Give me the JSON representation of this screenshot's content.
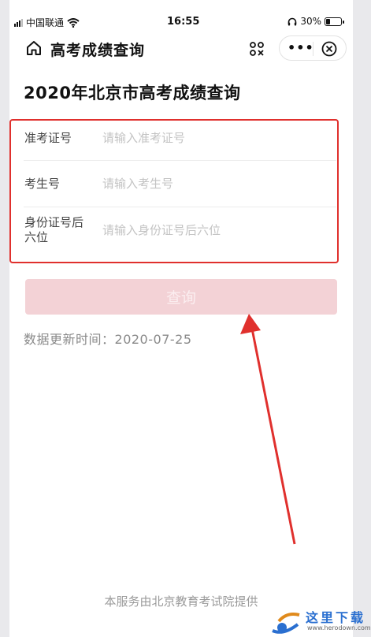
{
  "status_bar": {
    "carrier": "中国联通",
    "time": "16:55",
    "battery": "30%",
    "battery_level": 0.3
  },
  "nav": {
    "title": "高考成绩查询",
    "more_label": "•••"
  },
  "page": {
    "title": "2020年北京市高考成绩查询"
  },
  "form": {
    "fields": [
      {
        "label": "准考证号",
        "placeholder": "请输入准考证号",
        "value": ""
      },
      {
        "label": "考生号",
        "placeholder": "请输入考生号",
        "value": ""
      },
      {
        "label": "身份证号后六位",
        "placeholder": "请输入身份证号后六位",
        "value": ""
      }
    ],
    "submit_label": "查询"
  },
  "update": {
    "label": "数据更新时间：",
    "date": "2020-07-25"
  },
  "footer": {
    "text": "本服务由北京教育考试院提供"
  },
  "watermark": {
    "text": "这里下载",
    "sub": "www.herodown.com"
  },
  "colors": {
    "highlight": "#e0302d",
    "button_bg": "#f3d2d6",
    "watermark_blue": "#2a6fd0"
  }
}
